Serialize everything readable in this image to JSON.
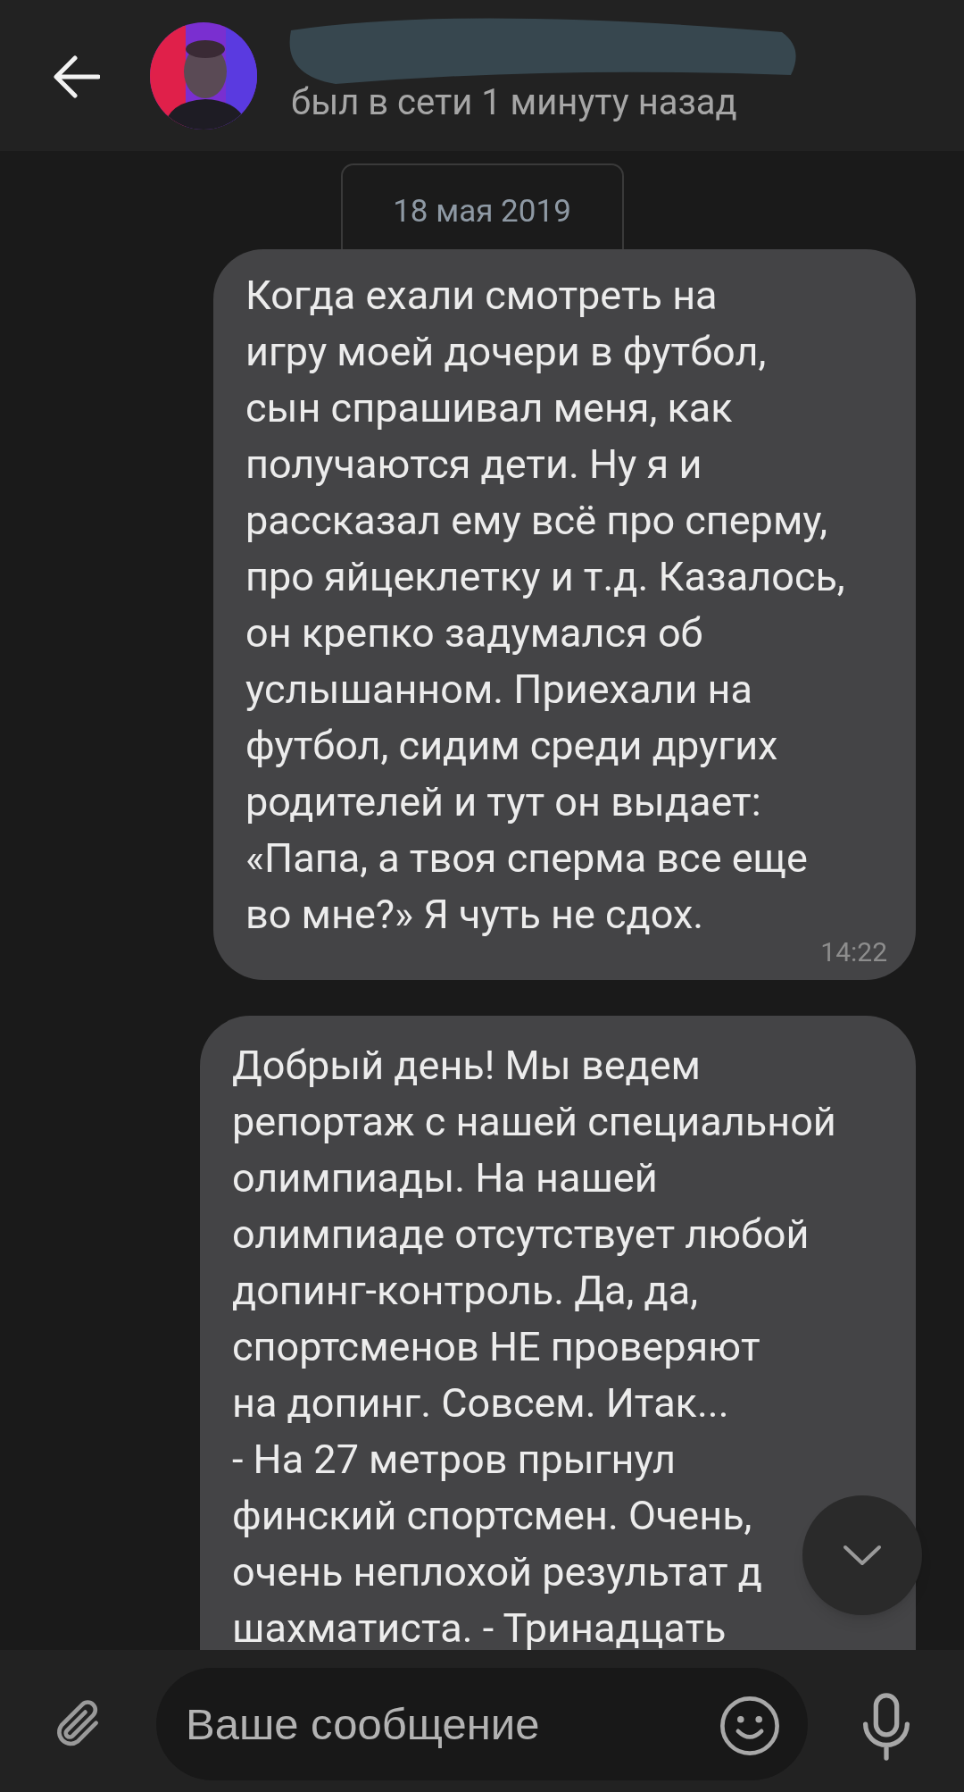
{
  "header": {
    "status": "был в сети 1 минуту назад"
  },
  "date_separator": "18 мая 2019",
  "messages": [
    {
      "text": "Когда ехали смотреть на\nигру моей дочери в футбол,\nсын спрашивал меня, как\nполучаются дети. Ну я и\nрассказал ему всё про сперму,\nпро яйцеклетку и т.д. Казалось,\nон крепко задумался об\nуслышанном. Приехали на\nфутбол, сидим среди других\nродителей и тут он выдает:\n«Папа, а твоя сперма все еще\nво мне?» Я чуть не сдох.",
      "time": "14:22"
    },
    {
      "text": "Добрый день! Мы ведем\nрепортаж с нашей специальной\nолимпиады. На нашей\nолимпиаде отсутствует любой\nдопинг-контроль. Да, да,\nспортсменов НЕ проверяют\nна допинг. Совсем. Итак...\n- На 27 метров прыгнул\nфинский спортсмен. Очень,\nочень неплохой результат д\nшахматиста. - Тринадцать"
    }
  ],
  "composer": {
    "placeholder": "Ваше сообщение"
  }
}
